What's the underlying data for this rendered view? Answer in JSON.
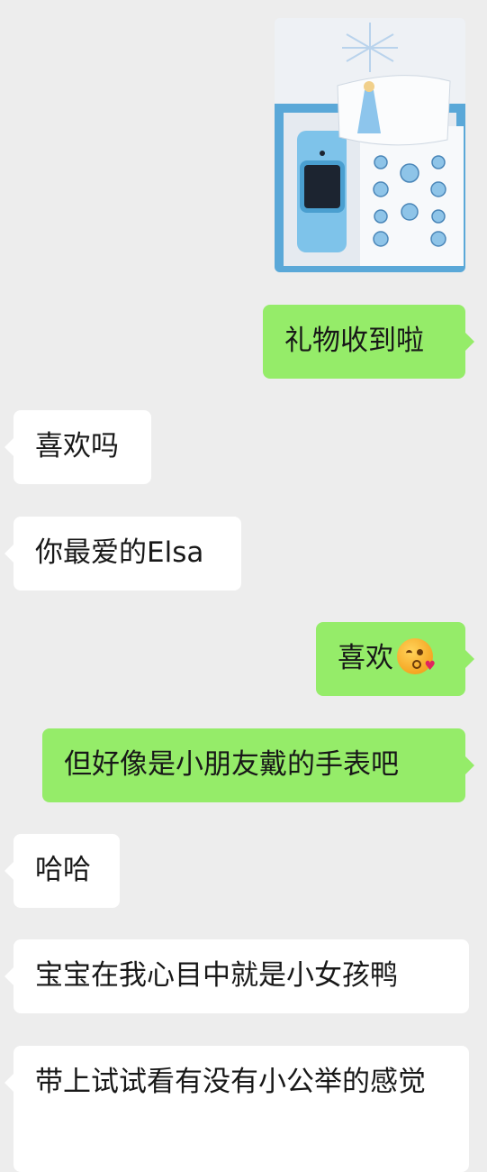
{
  "chat": {
    "messages": [
      {
        "side": "right",
        "text": "礼物收到啦"
      },
      {
        "side": "left",
        "text": "喜欢吗"
      },
      {
        "side": "left",
        "text": "你最爱的Elsa"
      },
      {
        "side": "right",
        "text": "喜欢",
        "emoji": "kissing-face-emoji"
      },
      {
        "side": "right",
        "text": "但好像是小朋友戴的手表吧"
      },
      {
        "side": "left",
        "text": "哈哈"
      },
      {
        "side": "left",
        "text": "宝宝在我心目中就是小女孩鸭"
      },
      {
        "side": "left",
        "text": "带上试试看有没有小公举的感觉"
      }
    ]
  },
  "colors": {
    "background": "#ededed",
    "sent_bubble": "#95ec69",
    "received_bubble": "#ffffff"
  },
  "icons": {
    "emoji": "kissing-face-emoji"
  }
}
